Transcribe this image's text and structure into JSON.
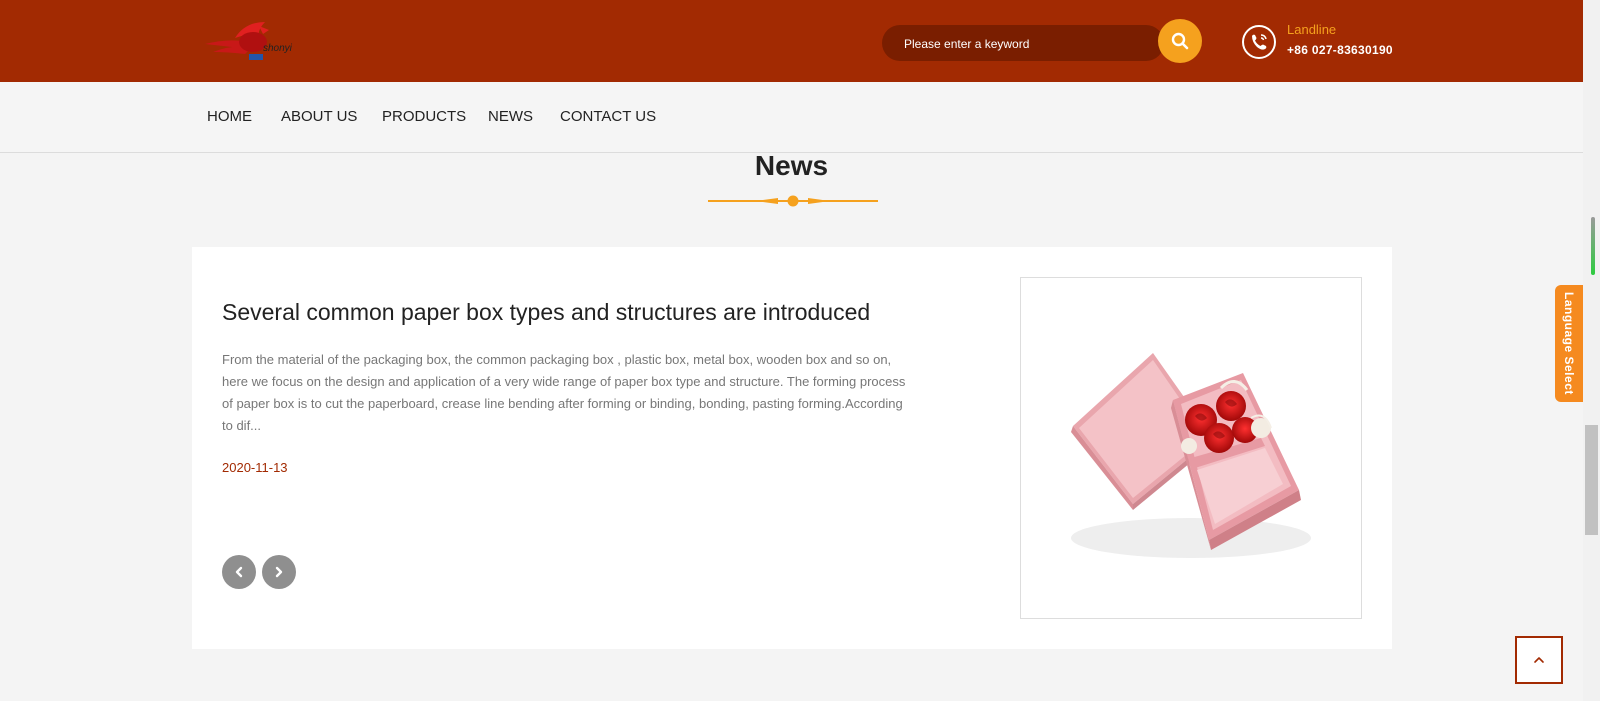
{
  "header": {
    "search": {
      "placeholder": "Please enter a keyword"
    },
    "contact": {
      "label": "Landline",
      "number": "+86 027-83630190"
    }
  },
  "nav": {
    "items": [
      {
        "label": "HOME"
      },
      {
        "label": "ABOUT US"
      },
      {
        "label": "PRODUCTS"
      },
      {
        "label": "NEWS"
      },
      {
        "label": "CONTACT US"
      }
    ]
  },
  "section": {
    "title": "News"
  },
  "news": {
    "title": "Several common paper box types and structures are introduced",
    "excerpt": "From the material of the packaging box, the common packaging box , plastic box, metal box, wooden box and so on, here we focus on the design and application of a very wide range of paper box type and structure. The forming process of paper box is to cut the paperboard, crease line bending after forming or binding, bonding, pasting forming.According to dif...",
    "date": "2020-11-13"
  },
  "sidebar": {
    "language_label": "Language Select"
  },
  "colors": {
    "brand": "#a22a02",
    "accent": "#f5a11e",
    "date": "#a22a02"
  },
  "icons": {
    "search": "search-icon",
    "phone": "phone-icon",
    "prev": "chevron-left-icon",
    "next": "chevron-right-icon",
    "back_top": "chevron-up-icon"
  }
}
